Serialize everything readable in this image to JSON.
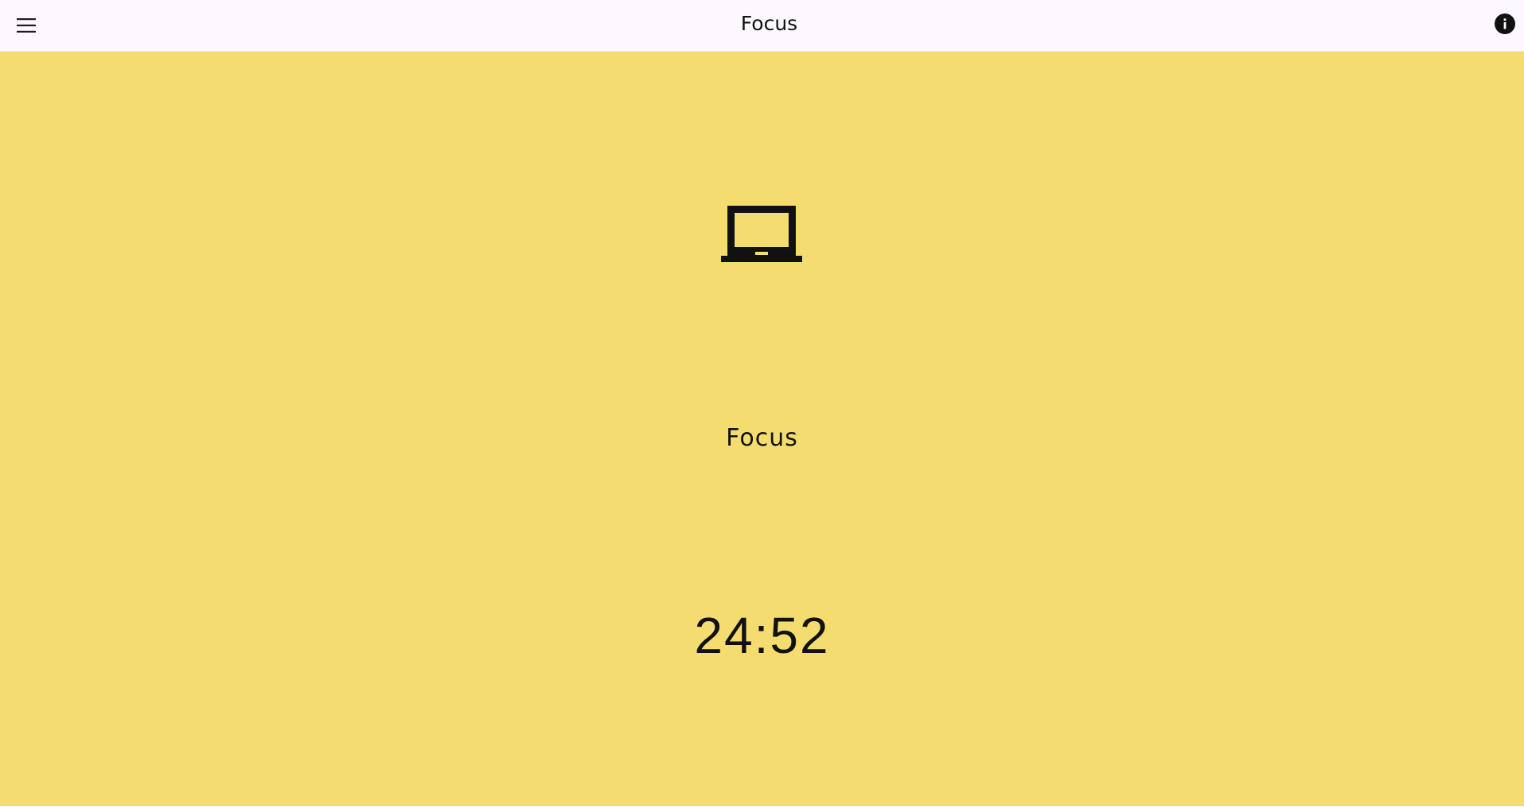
{
  "header": {
    "title": "Focus",
    "menu_icon": "hamburger-menu-icon",
    "info_icon": "info-icon"
  },
  "main": {
    "mode_icon": "laptop-icon",
    "mode_label": "Focus",
    "timer": "24:52"
  },
  "colors": {
    "focus_background": "#f5dc6e",
    "topbar_background": "#fdf7ff",
    "text": "#111111"
  }
}
